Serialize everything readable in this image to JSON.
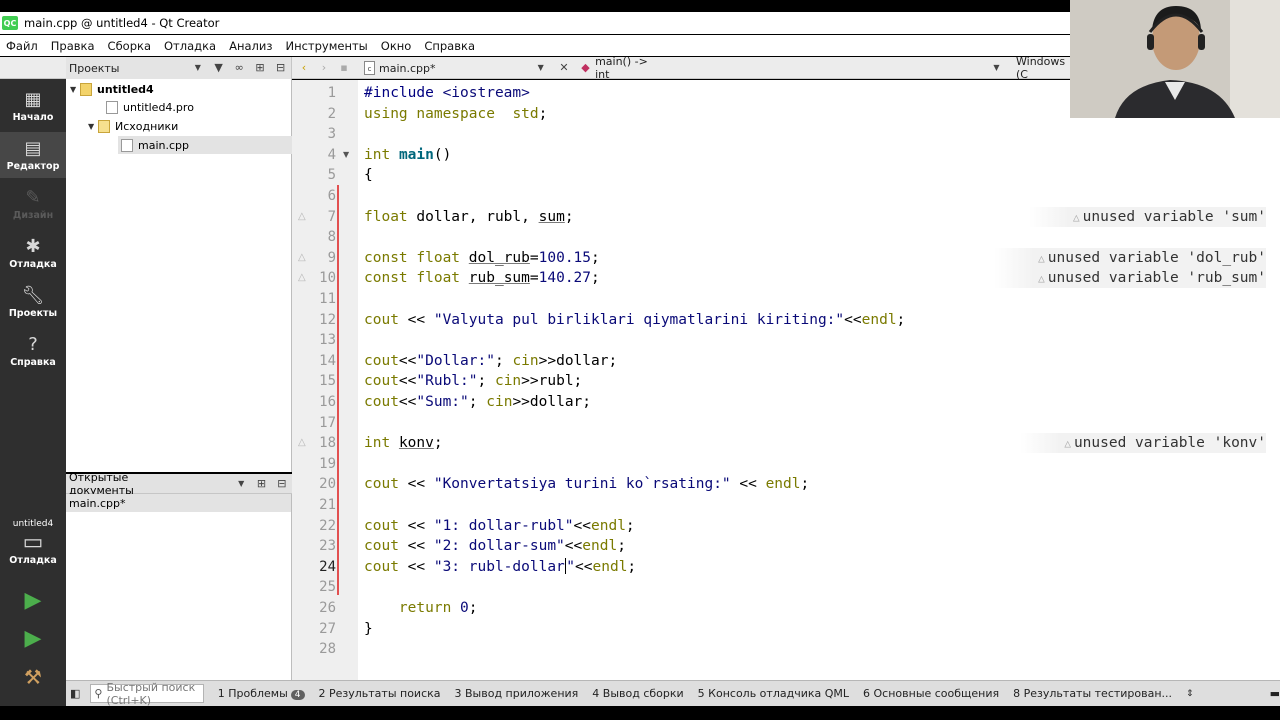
{
  "window": {
    "title": "main.cpp @ untitled4 - Qt Creator",
    "logo": "QC"
  },
  "menu": [
    "Файл",
    "Правка",
    "Сборка",
    "Отладка",
    "Анализ",
    "Инструменты",
    "Окно",
    "Справка"
  ],
  "toolbar": {
    "projects_label": "Проекты",
    "file_tab": "main.cpp*",
    "function_combo": "main() -> int",
    "line_ending": "Windows (C"
  },
  "modes": [
    {
      "label": "Начало",
      "icon": "grid-icon"
    },
    {
      "label": "Редактор",
      "icon": "editor-icon",
      "active": true
    },
    {
      "label": "Дизайн",
      "icon": "design-icon",
      "disabled": true
    },
    {
      "label": "Отладка",
      "icon": "bug-icon"
    },
    {
      "label": "Проекты",
      "icon": "wrench-icon"
    },
    {
      "label": "Справка",
      "icon": "help-icon"
    }
  ],
  "kit": {
    "project": "untitled4",
    "mode": "Отладка"
  },
  "project_tree": {
    "root": "untitled4",
    "pro_file": "untitled4.pro",
    "sources_folder": "Исходники",
    "source_file": "main.cpp"
  },
  "open_documents": {
    "header": "Открытые документы",
    "items": [
      "main.cpp*"
    ]
  },
  "editor": {
    "current_line": 24,
    "lines": [
      "#include <iostream>",
      "using namespace  std;",
      "",
      "int main()",
      "{",
      "",
      "float dollar, rubl, sum;",
      "",
      "const float dol_rub=100.15;",
      "const float rub_sum=140.27;",
      "",
      "cout << \"Valyuta pul birliklari qiymatlarini kiriting:\"<<endl;",
      "",
      "cout<<\"Dollar:\"; cin>>dollar;",
      "cout<<\"Rubl:\"; cin>>rubl;",
      "cout<<\"Sum:\"; cin>>dollar;",
      "",
      "int konv;",
      "",
      "cout << \"Konvertatsiya turini ko`rsating:\" << endl;",
      "",
      "cout << \"1: dollar-rubl\"<<endl;",
      "cout << \"2: dollar-sum\"<<endl;",
      "cout << \"3: rubl-dollar\"<<endl;",
      "",
      "    return 0;",
      "}",
      ""
    ],
    "warnings": [
      {
        "line": 7,
        "text": "unused variable 'sum'"
      },
      {
        "line": 9,
        "text": "unused variable 'dol_rub'"
      },
      {
        "line": 10,
        "text": "unused variable 'rub_sum'"
      },
      {
        "line": 18,
        "text": "unused variable 'konv'"
      }
    ]
  },
  "statusbar": {
    "search_placeholder": "Быстрый поиск (Ctrl+K)",
    "panes": [
      {
        "label": "1  Проблемы",
        "badge": "4"
      },
      {
        "label": "2  Результаты поиска"
      },
      {
        "label": "3  Вывод приложения"
      },
      {
        "label": "4  Вывод сборки"
      },
      {
        "label": "5  Консоль отладчика QML"
      },
      {
        "label": "6  Основные сообщения"
      },
      {
        "label": "8  Результаты тестирован..."
      }
    ]
  },
  "colors": {
    "accent": "#41cd52",
    "mode_bar": "#2f2f2f",
    "change_marker": "#e25050"
  }
}
